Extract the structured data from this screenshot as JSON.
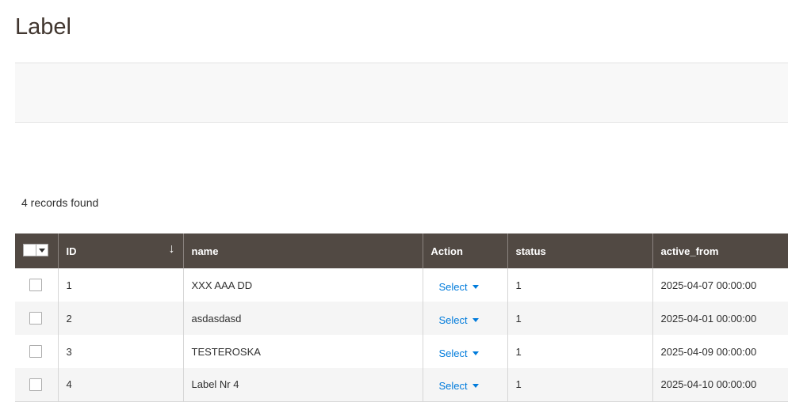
{
  "page": {
    "title": "Label"
  },
  "grid": {
    "records_found": "4 records found",
    "columns": [
      {
        "key": "id",
        "label": "ID",
        "sort_indicator": "↓"
      },
      {
        "key": "name",
        "label": "name"
      },
      {
        "key": "action",
        "label": "Action"
      },
      {
        "key": "status",
        "label": "status"
      },
      {
        "key": "active_from",
        "label": "active_from"
      }
    ],
    "rows": [
      {
        "id": "1",
        "name": "XXX AAA DD",
        "action": "Select",
        "status": "1",
        "active_from": "2025-04-07 00:00:00"
      },
      {
        "id": "2",
        "name": "asdasdasd",
        "action": "Select",
        "status": "1",
        "active_from": "2025-04-01 00:00:00"
      },
      {
        "id": "3",
        "name": "TESTEROSKA",
        "action": "Select",
        "status": "1",
        "active_from": "2025-04-09 00:00:00"
      },
      {
        "id": "4",
        "name": "Label Nr 4",
        "action": "Select",
        "status": "1",
        "active_from": "2025-04-10 00:00:00"
      }
    ]
  },
  "colors": {
    "header_bg": "#514943",
    "link": "#007bdb",
    "title": "#41362f"
  },
  "icons": {
    "mass_select": "checkbox-dropdown-icon",
    "sort": "arrow-down-icon",
    "action_caret": "caret-down-icon"
  }
}
